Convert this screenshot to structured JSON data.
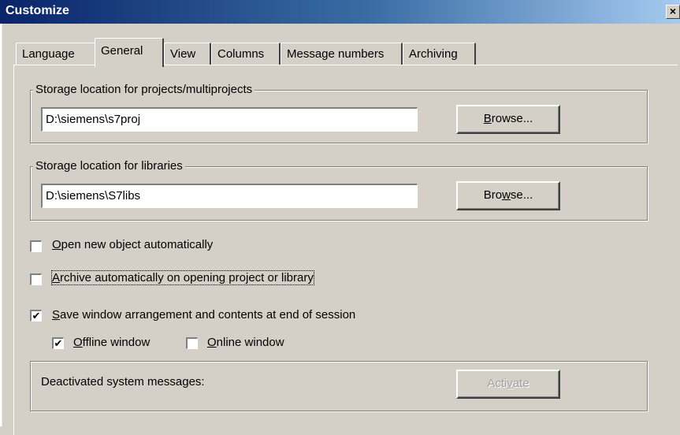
{
  "window": {
    "title": "Customize",
    "close_glyph": "×"
  },
  "tabs": [
    {
      "label": "Language",
      "active": false
    },
    {
      "label": "General",
      "active": true
    },
    {
      "label": "View",
      "active": false
    },
    {
      "label": "Columns",
      "active": false
    },
    {
      "label": "Message numbers",
      "active": false
    },
    {
      "label": "Archiving",
      "active": false
    }
  ],
  "projects_group": {
    "legend": "Storage location for projects/multiprojects",
    "path_value": "D:\\siemens\\s7proj",
    "browse_label_pre": "",
    "browse_label_key": "B",
    "browse_label_post": "rowse..."
  },
  "libraries_group": {
    "legend": "Storage location for libraries",
    "path_value": "D:\\siemens\\S7libs",
    "browse_label_pre": "Bro",
    "browse_label_key": "w",
    "browse_label_post": "se..."
  },
  "options": {
    "open_new_object": {
      "checked": false,
      "key": "O",
      "rest": "pen new object automatically"
    },
    "archive_auto": {
      "checked": false,
      "key": "A",
      "rest": "rchive automatically on opening project or library"
    },
    "save_window": {
      "checked": true,
      "key": "S",
      "rest": "ave window arrangement and contents at end of session"
    },
    "offline_window": {
      "checked": true,
      "key": "O",
      "rest": "ffline window"
    },
    "online_window": {
      "checked": false,
      "key": "O",
      "rest": "nline window"
    }
  },
  "system_messages": {
    "label": "Deactivated system messages:",
    "activate_pre": "Acti",
    "activate_key": "v",
    "activate_post": "ate",
    "activate_enabled": false
  },
  "check_glyph": "✔"
}
